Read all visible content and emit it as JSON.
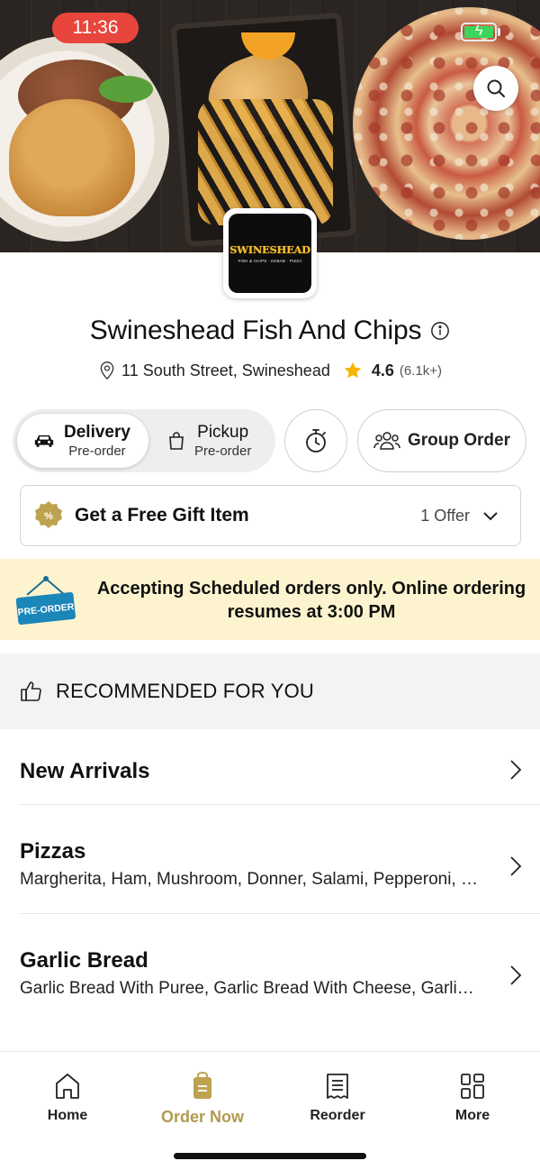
{
  "status_bar": {
    "time": "11:36"
  },
  "store": {
    "logo_text": "SWINESHEAD",
    "logo_subtext": "FISH & CHIPS · KEBAB · PIZZA",
    "name": "Swineshead Fish And Chips",
    "address": "11 South Street, Swineshead",
    "rating": "4.6",
    "rating_count": "(6.1k+)"
  },
  "order_modes": {
    "delivery": {
      "title": "Delivery",
      "subtitle": "Pre-order",
      "selected": true
    },
    "pickup": {
      "title": "Pickup",
      "subtitle": "Pre-order",
      "selected": false
    },
    "group_order_label": "Group Order"
  },
  "offer": {
    "title": "Get a Free Gift Item",
    "count": "1 Offer"
  },
  "banner": {
    "sign_text": "PRE-ORDER",
    "message": "Accepting Scheduled orders only. Online ordering resumes at 3:00 PM"
  },
  "recommended": {
    "title": "RECOMMENDED FOR YOU"
  },
  "categories": [
    {
      "name": "New Arrivals",
      "desc": ""
    },
    {
      "name": "Pizzas",
      "desc": "Margherita, Ham, Mushroom, Donner, Salami, Pepperoni, Hawaiian"
    },
    {
      "name": "Garlic Bread",
      "desc": "Garlic Bread With Puree, Garlic Bread With Cheese, Garlic Bread"
    }
  ],
  "nav": {
    "items": [
      {
        "label": "Home",
        "icon": "home-icon"
      },
      {
        "label": "Order Now",
        "icon": "order-bag-icon",
        "active": true
      },
      {
        "label": "Reorder",
        "icon": "receipt-icon"
      },
      {
        "label": "More",
        "icon": "grid-icon"
      }
    ]
  },
  "colors": {
    "accent": "#b39a4f",
    "banner_bg": "#fdf4cf",
    "time_pill": "#e8453c",
    "star": "#f5b400",
    "preorder_sign": "#1b86b8"
  }
}
